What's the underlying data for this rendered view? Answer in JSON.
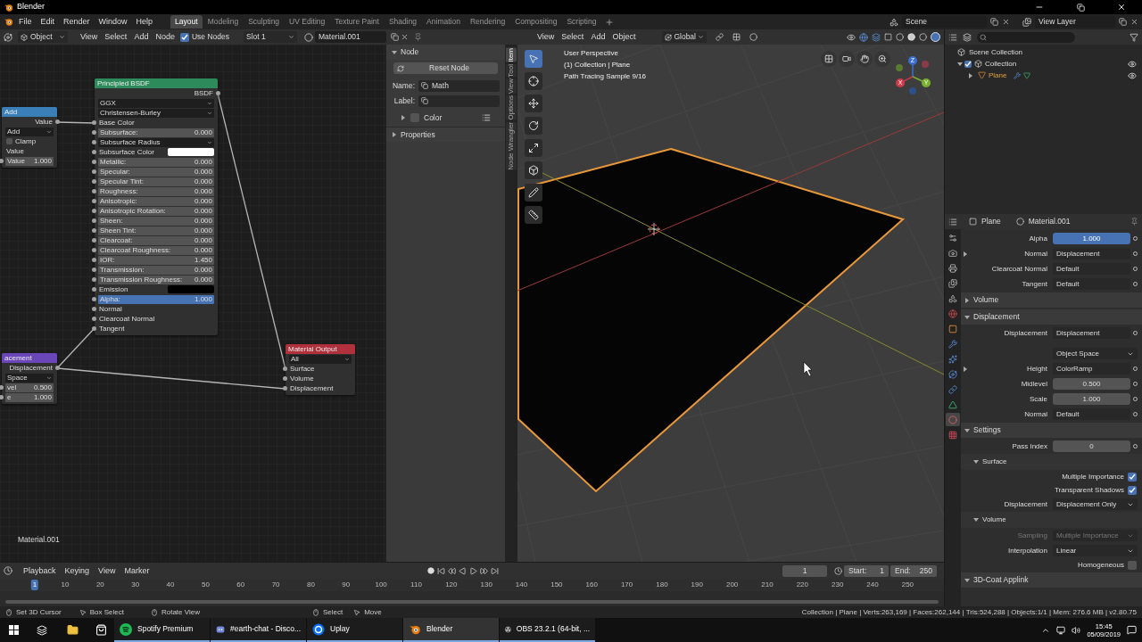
{
  "title_bar": {
    "title": "Blender"
  },
  "menu": [
    "File",
    "Edit",
    "Render",
    "Window",
    "Help"
  ],
  "workspaces": [
    {
      "label": "Layout",
      "selected": true
    },
    {
      "label": "Modeling",
      "selected": false
    },
    {
      "label": "Sculpting",
      "selected": false
    },
    {
      "label": "UV Editing",
      "selected": false
    },
    {
      "label": "Texture Paint",
      "selected": false
    },
    {
      "label": "Shading",
      "selected": false
    },
    {
      "label": "Animation",
      "selected": false
    },
    {
      "label": "Rendering",
      "selected": false
    },
    {
      "label": "Compositing",
      "selected": false
    },
    {
      "label": "Scripting",
      "selected": false
    }
  ],
  "scene": "Scene",
  "view_layer": "View Layer",
  "node_editor": {
    "header": {
      "mode": "Object",
      "menus": [
        "View",
        "Select",
        "Add",
        "Node"
      ],
      "use_nodes": {
        "label": "Use Nodes",
        "checked": true
      },
      "slot": "Slot 1",
      "material": "Material.001"
    },
    "nodes": [
      {
        "title": "Add",
        "color": "#3a7fb8",
        "rows": [
          {
            "kind": "output",
            "label": "Value",
            "socket": true
          },
          {
            "kind": "dropdown",
            "label": "Add",
            "socket": false
          },
          {
            "kind": "checkbox",
            "label": "Clamp",
            "checked": false
          },
          {
            "kind": "label",
            "label": "Value"
          },
          {
            "kind": "value",
            "label": "Value",
            "value": "1.000",
            "active": false,
            "socket": true
          }
        ]
      },
      {
        "title": "Principled BSDF",
        "color": "#2d8a5a",
        "rows": [
          {
            "kind": "output",
            "label": "BSDF",
            "socket": true
          },
          {
            "kind": "dropdown",
            "label": "GGX",
            "socket": false
          },
          {
            "kind": "dropdown",
            "label": "Christensen-Burley",
            "socket": false
          },
          {
            "kind": "socket",
            "label": "Base Color",
            "socket": true
          },
          {
            "kind": "value",
            "label": "Subsurface:",
            "value": "0.000",
            "active": false,
            "socket": true
          },
          {
            "kind": "dropdown",
            "label": "Subsurface Radius",
            "socket": true
          },
          {
            "kind": "swatch",
            "label": "Subsurface Color",
            "color": "#ffffff",
            "socket": true
          },
          {
            "kind": "value",
            "label": "Metallic:",
            "value": "0.000",
            "active": false,
            "socket": true
          },
          {
            "kind": "value",
            "label": "Specular:",
            "value": "0.000",
            "active": false,
            "socket": true
          },
          {
            "kind": "value",
            "label": "Specular Tint:",
            "value": "0.000",
            "active": false,
            "socket": true
          },
          {
            "kind": "value",
            "label": "Roughness:",
            "value": "0.000",
            "active": false,
            "socket": true
          },
          {
            "kind": "value",
            "label": "Anisotropic:",
            "value": "0.000",
            "active": false,
            "socket": true
          },
          {
            "kind": "value",
            "label": "Anisotropic Rotation:",
            "value": "0.000",
            "active": false,
            "socket": true
          },
          {
            "kind": "value",
            "label": "Sheen:",
            "value": "0.000",
            "active": false,
            "socket": true
          },
          {
            "kind": "value",
            "label": "Sheen Tint:",
            "value": "0.000",
            "active": false,
            "socket": true
          },
          {
            "kind": "value",
            "label": "Clearcoat:",
            "value": "0.000",
            "active": false,
            "socket": true
          },
          {
            "kind": "value",
            "label": "Clearcoat Roughness:",
            "value": "0.000",
            "active": false,
            "socket": true
          },
          {
            "kind": "value",
            "label": "IOR:",
            "value": "1.450",
            "active": false,
            "socket": true
          },
          {
            "kind": "value",
            "label": "Transmission:",
            "value": "0.000",
            "active": false,
            "socket": true
          },
          {
            "kind": "value",
            "label": "Transmission Roughness:",
            "value": "0.000",
            "active": false,
            "socket": true
          },
          {
            "kind": "swatch",
            "label": "Emission",
            "color": "#000000",
            "socket": true
          },
          {
            "kind": "value",
            "label": "Alpha:",
            "value": "1.000",
            "active": true,
            "socket": true
          },
          {
            "kind": "socket",
            "label": "Normal",
            "socket": true
          },
          {
            "kind": "socket",
            "label": "Clearcoat Normal",
            "socket": true
          },
          {
            "kind": "socket",
            "label": "Tangent",
            "socket": true
          }
        ]
      },
      {
        "title": "acement",
        "color": "#6a46b8",
        "rows": [
          {
            "kind": "output",
            "label": "Displacement",
            "socket": true
          },
          {
            "kind": "dropdown",
            "label": "Space",
            "socket": false
          },
          {
            "kind": "value",
            "label": "vel",
            "value": "0.500",
            "active": false,
            "socket": true
          },
          {
            "kind": "value",
            "label": "e",
            "value": "1.000",
            "active": false,
            "socket": true
          }
        ]
      },
      {
        "title": "Material Output",
        "color": "#b0303c",
        "rows": [
          {
            "kind": "dropdown",
            "label": "All",
            "socket": false
          },
          {
            "kind": "socket",
            "label": "Surface",
            "socket": true
          },
          {
            "kind": "socket",
            "label": "Volume",
            "socket": true
          },
          {
            "kind": "socket",
            "label": "Displacement",
            "socket": true
          }
        ]
      }
    ],
    "material_label": "Material.001"
  },
  "sidebar": {
    "panel": {
      "label": "Node",
      "expanded": true
    },
    "reset_button": "Reset Node",
    "name_label": "Name:",
    "name_value": "Math",
    "label_label": "Label:",
    "color": {
      "label": "Color",
      "checked": false,
      "expanded": false
    },
    "properties_panel": {
      "label": "Properties",
      "expanded": false
    },
    "tabs": [
      {
        "label": "Item",
        "selected": true
      },
      {
        "label": "Tool",
        "selected": false
      },
      {
        "label": "View",
        "selected": false
      },
      {
        "label": "Options",
        "selected": false
      },
      {
        "label": "Node Wrangler",
        "selected": false
      }
    ]
  },
  "viewport": {
    "menus": [
      "View",
      "Select",
      "Add",
      "Object"
    ],
    "orientation": "Global",
    "overlay": [
      "User Perspective",
      "(1) Collection | Plane",
      "Path Tracing Sample 9/16"
    ],
    "tools": [
      {
        "kind": "select",
        "selected": true
      },
      {
        "kind": "cursor",
        "selected": false
      },
      {
        "kind": "move",
        "selected": false
      },
      {
        "kind": "rotate",
        "selected": false
      },
      {
        "kind": "scale",
        "selected": false
      },
      {
        "kind": "transform",
        "selected": false
      },
      {
        "kind": "annotate",
        "selected": false
      },
      {
        "kind": "measure",
        "selected": false
      }
    ],
    "gizmo_axes": [
      "Z",
      "X",
      "Y"
    ]
  },
  "outliner": {
    "root": "Scene Collection",
    "children": [
      {
        "label": "Collection",
        "checked": true,
        "expanded": true,
        "children": [
          {
            "label": "Plane",
            "expanded": false
          }
        ]
      }
    ]
  },
  "properties": {
    "object": "Plane",
    "material": "Material.001",
    "tabs": [
      {
        "kind": "tool",
        "selected": false
      },
      {
        "kind": "render",
        "selected": false
      },
      {
        "kind": "output",
        "selected": false
      },
      {
        "kind": "view_layer",
        "selected": false
      },
      {
        "kind": "scene",
        "selected": false
      },
      {
        "kind": "world",
        "selected": false
      },
      {
        "kind": "object",
        "selected": false
      },
      {
        "kind": "modifiers",
        "selected": false
      },
      {
        "kind": "particles",
        "selected": false
      },
      {
        "kind": "physics",
        "selected": false
      },
      {
        "kind": "constraints",
        "selected": false
      },
      {
        "kind": "data",
        "selected": false
      },
      {
        "kind": "material",
        "selected": true
      },
      {
        "kind": "texture",
        "selected": false
      }
    ],
    "rows": [
      {
        "kind": "number",
        "label": "Alpha",
        "value": "1.000",
        "active": true
      },
      {
        "kind": "link",
        "label": "Normal",
        "value": "Displacement",
        "expandable": true
      },
      {
        "kind": "link",
        "label": "Clearcoat Normal",
        "value": "Default",
        "expandable": false
      },
      {
        "kind": "link",
        "label": "Tangent",
        "value": "Default",
        "expandable": false
      },
      {
        "kind": "panel",
        "label": "Volume",
        "expanded": false
      },
      {
        "kind": "panel",
        "label": "Displacement",
        "expanded": true
      },
      {
        "kind": "link",
        "label": "Displacement",
        "value": "Displacement",
        "expandable": false
      },
      {
        "kind": "dropdown",
        "value": "Object Space",
        "disabled": false
      },
      {
        "kind": "link",
        "label": "Height",
        "value": "ColorRamp",
        "expandable": true
      },
      {
        "kind": "number",
        "label": "Midlevel",
        "value": "0.500",
        "active": false
      },
      {
        "kind": "number",
        "label": "Scale",
        "value": "1.000",
        "active": false
      },
      {
        "kind": "link",
        "label": "Normal",
        "value": "Default",
        "expandable": false
      },
      {
        "kind": "panel",
        "label": "Settings",
        "expanded": true
      },
      {
        "kind": "number",
        "label": "Pass Index",
        "value": "0",
        "active": false
      },
      {
        "kind": "subpanel",
        "label": "Surface",
        "expanded": true
      },
      {
        "kind": "checkbox",
        "label": "Multiple Importance",
        "checked": true
      },
      {
        "kind": "checkbox",
        "label": "Transparent Shadows",
        "checked": true
      },
      {
        "kind": "dropdown",
        "label": "Displacement",
        "value": "Displacement Only",
        "disabled": false
      },
      {
        "kind": "subpanel",
        "label": "Volume",
        "expanded": true
      },
      {
        "kind": "dropdown",
        "label": "Sampling",
        "value": "Multiple Importance",
        "disabled": true
      },
      {
        "kind": "dropdown",
        "label": "Interpolation",
        "value": "Linear",
        "disabled": false
      },
      {
        "kind": "checkbox",
        "label": "Homogeneous",
        "checked": false
      },
      {
        "kind": "panel",
        "label": "3D-Coat Applink",
        "expanded": true
      }
    ]
  },
  "timeline": {
    "menus": [
      "Playback",
      "Keying",
      "View",
      "Marker"
    ],
    "current_frame": "1",
    "start_label": "Start:",
    "start": "1",
    "end_label": "End:",
    "end": "250",
    "ruler": [
      {
        "label": "1",
        "selected": true
      },
      {
        "label": "10",
        "selected": false
      },
      {
        "label": "20",
        "selected": false
      },
      {
        "label": "30",
        "selected": false
      },
      {
        "label": "40",
        "selected": false
      },
      {
        "label": "50",
        "selected": false
      },
      {
        "label": "60",
        "selected": false
      },
      {
        "label": "70",
        "selected": false
      },
      {
        "label": "80",
        "selected": false
      },
      {
        "label": "90",
        "selected": false
      },
      {
        "label": "100",
        "selected": false
      },
      {
        "label": "110",
        "selected": false
      },
      {
        "label": "120",
        "selected": false
      },
      {
        "label": "130",
        "selected": false
      },
      {
        "label": "140",
        "selected": false
      },
      {
        "label": "150",
        "selected": false
      },
      {
        "label": "160",
        "selected": false
      },
      {
        "label": "170",
        "selected": false
      },
      {
        "label": "180",
        "selected": false
      },
      {
        "label": "190",
        "selected": false
      },
      {
        "label": "200",
        "selected": false
      },
      {
        "label": "210",
        "selected": false
      },
      {
        "label": "220",
        "selected": false
      },
      {
        "label": "230",
        "selected": false
      },
      {
        "label": "240",
        "selected": false
      },
      {
        "label": "250",
        "selected": false
      }
    ]
  },
  "status_bar": {
    "hints": [
      {
        "kind": "mouse_left",
        "label": "Set 3D Cursor"
      },
      {
        "kind": "mouse_drag",
        "label": "Box Select"
      },
      {
        "kind": "mouse_middle",
        "label": "Rotate View"
      },
      {
        "kind": "mouse_left",
        "label": "Select"
      },
      {
        "kind": "mouse_drag",
        "label": "Move"
      }
    ],
    "stats": "Collection | Plane | Verts:263,169 | Faces:262,144 | Tris:524,288 | Objects:1/1 | Mem: 276.6 MB | v2.80.75"
  },
  "taskbar": {
    "apps": [
      {
        "kind": "spotify",
        "label": "Spotify Premium",
        "selected": false
      },
      {
        "kind": "discord",
        "label": "#earth-chat - Disco...",
        "selected": false
      },
      {
        "kind": "uplay",
        "label": "Uplay",
        "selected": false
      },
      {
        "kind": "blender",
        "label": "Blender",
        "selected": true
      },
      {
        "kind": "obs",
        "label": "OBS 23.2.1 (64-bit, ...",
        "selected": false
      }
    ],
    "time": "15:45",
    "date": "05/09/2019"
  }
}
